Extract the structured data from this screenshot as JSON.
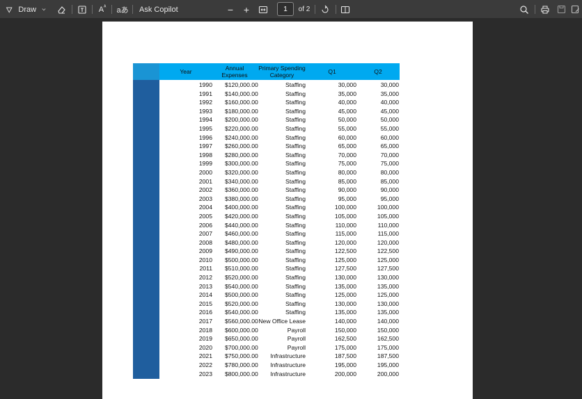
{
  "toolbar": {
    "draw_label": "Draw",
    "ask_copilot_label": "Ask Copilot",
    "zoom_out_label": "−",
    "zoom_in_label": "+",
    "page_number": "1",
    "page_total": "of 2",
    "font_size_label": "A",
    "read_aloud_label": "aあ"
  },
  "table": {
    "headers": {
      "year": "Year",
      "annual_expenses": "Annual Expenses",
      "primary_category": "Primary Spending Category",
      "q1": "Q1",
      "q2": "Q2"
    },
    "rows": [
      {
        "year": "1990",
        "expenses": "$120,000.00",
        "category": "Staffing",
        "q1": "30,000",
        "q2": "30,000"
      },
      {
        "year": "1991",
        "expenses": "$140,000.00",
        "category": "Staffing",
        "q1": "35,000",
        "q2": "35,000"
      },
      {
        "year": "1992",
        "expenses": "$160,000.00",
        "category": "Staffing",
        "q1": "40,000",
        "q2": "40,000"
      },
      {
        "year": "1993",
        "expenses": "$180,000.00",
        "category": "Staffing",
        "q1": "45,000",
        "q2": "45,000"
      },
      {
        "year": "1994",
        "expenses": "$200,000.00",
        "category": "Staffing",
        "q1": "50,000",
        "q2": "50,000"
      },
      {
        "year": "1995",
        "expenses": "$220,000.00",
        "category": "Staffing",
        "q1": "55,000",
        "q2": "55,000"
      },
      {
        "year": "1996",
        "expenses": "$240,000.00",
        "category": "Staffing",
        "q1": "60,000",
        "q2": "60,000"
      },
      {
        "year": "1997",
        "expenses": "$260,000.00",
        "category": "Staffing",
        "q1": "65,000",
        "q2": "65,000"
      },
      {
        "year": "1998",
        "expenses": "$280,000.00",
        "category": "Staffing",
        "q1": "70,000",
        "q2": "70,000"
      },
      {
        "year": "1999",
        "expenses": "$300,000.00",
        "category": "Staffing",
        "q1": "75,000",
        "q2": "75,000"
      },
      {
        "year": "2000",
        "expenses": "$320,000.00",
        "category": "Staffing",
        "q1": "80,000",
        "q2": "80,000"
      },
      {
        "year": "2001",
        "expenses": "$340,000.00",
        "category": "Staffing",
        "q1": "85,000",
        "q2": "85,000"
      },
      {
        "year": "2002",
        "expenses": "$360,000.00",
        "category": "Staffing",
        "q1": "90,000",
        "q2": "90,000"
      },
      {
        "year": "2003",
        "expenses": "$380,000.00",
        "category": "Staffing",
        "q1": "95,000",
        "q2": "95,000"
      },
      {
        "year": "2004",
        "expenses": "$400,000.00",
        "category": "Staffing",
        "q1": "100,000",
        "q2": "100,000"
      },
      {
        "year": "2005",
        "expenses": "$420,000.00",
        "category": "Staffing",
        "q1": "105,000",
        "q2": "105,000"
      },
      {
        "year": "2006",
        "expenses": "$440,000.00",
        "category": "Staffing",
        "q1": "110,000",
        "q2": "110,000"
      },
      {
        "year": "2007",
        "expenses": "$460,000.00",
        "category": "Staffing",
        "q1": "115,000",
        "q2": "115,000"
      },
      {
        "year": "2008",
        "expenses": "$480,000.00",
        "category": "Staffing",
        "q1": "120,000",
        "q2": "120,000"
      },
      {
        "year": "2009",
        "expenses": "$490,000.00",
        "category": "Staffing",
        "q1": "122,500",
        "q2": "122,500"
      },
      {
        "year": "2010",
        "expenses": "$500,000.00",
        "category": "Staffing",
        "q1": "125,000",
        "q2": "125,000"
      },
      {
        "year": "2011",
        "expenses": "$510,000.00",
        "category": "Staffing",
        "q1": "127,500",
        "q2": "127,500"
      },
      {
        "year": "2012",
        "expenses": "$520,000.00",
        "category": "Staffing",
        "q1": "130,000",
        "q2": "130,000"
      },
      {
        "year": "2013",
        "expenses": "$540,000.00",
        "category": "Staffing",
        "q1": "135,000",
        "q2": "135,000"
      },
      {
        "year": "2014",
        "expenses": "$500,000.00",
        "category": "Staffing",
        "q1": "125,000",
        "q2": "125,000"
      },
      {
        "year": "2015",
        "expenses": "$520,000.00",
        "category": "Staffing",
        "q1": "130,000",
        "q2": "130,000"
      },
      {
        "year": "2016",
        "expenses": "$540,000.00",
        "category": "Staffing",
        "q1": "135,000",
        "q2": "135,000"
      },
      {
        "year": "2017",
        "expenses": "$560,000.00",
        "category": "New Office Lease",
        "q1": "140,000",
        "q2": "140,000"
      },
      {
        "year": "2018",
        "expenses": "$600,000.00",
        "category": "Payroll",
        "q1": "150,000",
        "q2": "150,000"
      },
      {
        "year": "2019",
        "expenses": "$650,000.00",
        "category": "Payroll",
        "q1": "162,500",
        "q2": "162,500"
      },
      {
        "year": "2020",
        "expenses": "$700,000.00",
        "category": "Payroll",
        "q1": "175,000",
        "q2": "175,000"
      },
      {
        "year": "2021",
        "expenses": "$750,000.00",
        "category": "Infrastructure",
        "q1": "187,500",
        "q2": "187,500"
      },
      {
        "year": "2022",
        "expenses": "$780,000.00",
        "category": "Infrastructure",
        "q1": "195,000",
        "q2": "195,000"
      },
      {
        "year": "2023",
        "expenses": "$800,000.00",
        "category": "Infrastructure",
        "q1": "200,000",
        "q2": "200,000"
      }
    ]
  }
}
